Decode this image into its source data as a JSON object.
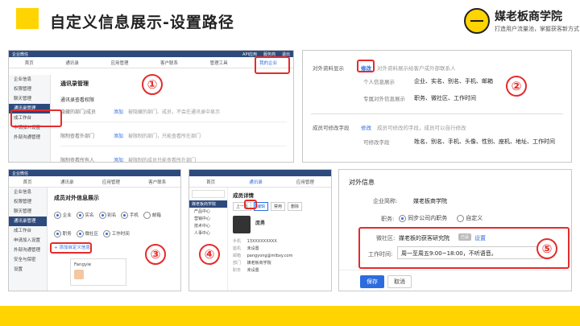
{
  "title": "自定义信息展示-设置路径",
  "logo": {
    "name": "媒老板商学院",
    "tagline": "打造用户流量池，掌握获客新方式"
  },
  "steps": [
    "①",
    "②",
    "③",
    "④",
    "⑤"
  ],
  "shot1": {
    "nav": [
      "企业微信",
      "API应用",
      "服务商",
      "退出"
    ],
    "tabs": [
      "首页",
      "通讯录",
      "应用管理",
      "客户联系",
      "管理工具",
      "我的企业"
    ],
    "side": [
      "企业信息",
      "权限管理",
      "聊天管理",
      "通讯录管理",
      "成工作台",
      "申请加入设置",
      "外部沟通管理"
    ],
    "heading": "通讯录管理",
    "sub": "通讯录查看权限",
    "rows": [
      {
        "label": "隐藏的部门/成员",
        "action": "添加",
        "desc": "被隐藏的部门、成员，不会在通讯录中显示"
      },
      {
        "label": "限制查看外部门",
        "action": "添加",
        "desc": "被限制的部门，只能查看所在部门"
      },
      {
        "label": "限制查看所有人",
        "action": "添加",
        "desc": "被限制的成员只能查看所在部门"
      }
    ]
  },
  "shot2": {
    "row1_label": "对外资料显示",
    "row1_action": "修改",
    "row1_desc": "对外资料展示给客户或外部联系人",
    "sub1_label": "个人信息展示",
    "sub1_value": "企业、实名、别名、手机、邮箱",
    "sub2_label": "专属对外信息展示",
    "sub2_value": "职务、微社区、工作时间",
    "row2_label": "成员可修改字段",
    "row2_action": "修改",
    "row2_desc": "成员可修改的字段，成员可以自行修改",
    "sub3_label": "可修改字段",
    "sub3_value": "姓名、别名、手机、头像、性别、座机、地址、工作时间"
  },
  "shot3": {
    "nav": [
      "企业微信"
    ],
    "tabs": [
      "首页",
      "通讯录",
      "应用管理",
      "客户联系"
    ],
    "side": [
      "企业信息",
      "权限管理",
      "聊天管理",
      "通讯录管理",
      "成工作台",
      "申请加入设置",
      "外部沟通管理",
      "安全与保密",
      "设置"
    ],
    "heading": "成员对外信息展示",
    "options1": [
      "企业",
      "实名",
      "别名",
      "手机",
      "邮箱"
    ],
    "options2": [
      "职务",
      "微社区",
      "工作时间"
    ],
    "add_label": "+ 添加自定义信息",
    "preview_name": "Fangyie"
  },
  "shot4": {
    "tabs": [
      "首页",
      "通讯录",
      "应用管理"
    ],
    "heading": "成员详情",
    "tree": [
      "媒老板商学院",
      "产品中心",
      "营销中心",
      "技术中心",
      "人事中心"
    ],
    "buttons": [
      "上一页",
      "编辑",
      "禁用",
      "删除"
    ],
    "person_name": "庞勇",
    "fields": [
      {
        "k": "手机",
        "v": "13XXXXXXXXX"
      },
      {
        "k": "座机",
        "v": "未设置"
      },
      {
        "k": "邮箱",
        "v": "pangyong@mlbxy.com"
      },
      {
        "k": "部门",
        "v": "媒老板商学院"
      },
      {
        "k": "职务",
        "v": "未设置"
      }
    ]
  },
  "shot5": {
    "section": "对外信息",
    "company_label": "企业简称:",
    "company_value": "媒老板商学院",
    "position_label": "职务:",
    "position_opt1": "同步公司内职务",
    "position_opt2": "自定义",
    "community_label": "微社区:",
    "community_value": "媒老板的获客研究院",
    "community_tag": "已设",
    "community_link": "设置",
    "worktime_label": "工作时间:",
    "worktime_value": "周一至周五9:00~18:00，不听语音。",
    "save": "保存",
    "cancel": "取消"
  },
  "colors": {
    "accent": "#ffd400",
    "red": "#e52b2b",
    "nav": "#2d4a7c",
    "blue": "#2d6cdf"
  }
}
